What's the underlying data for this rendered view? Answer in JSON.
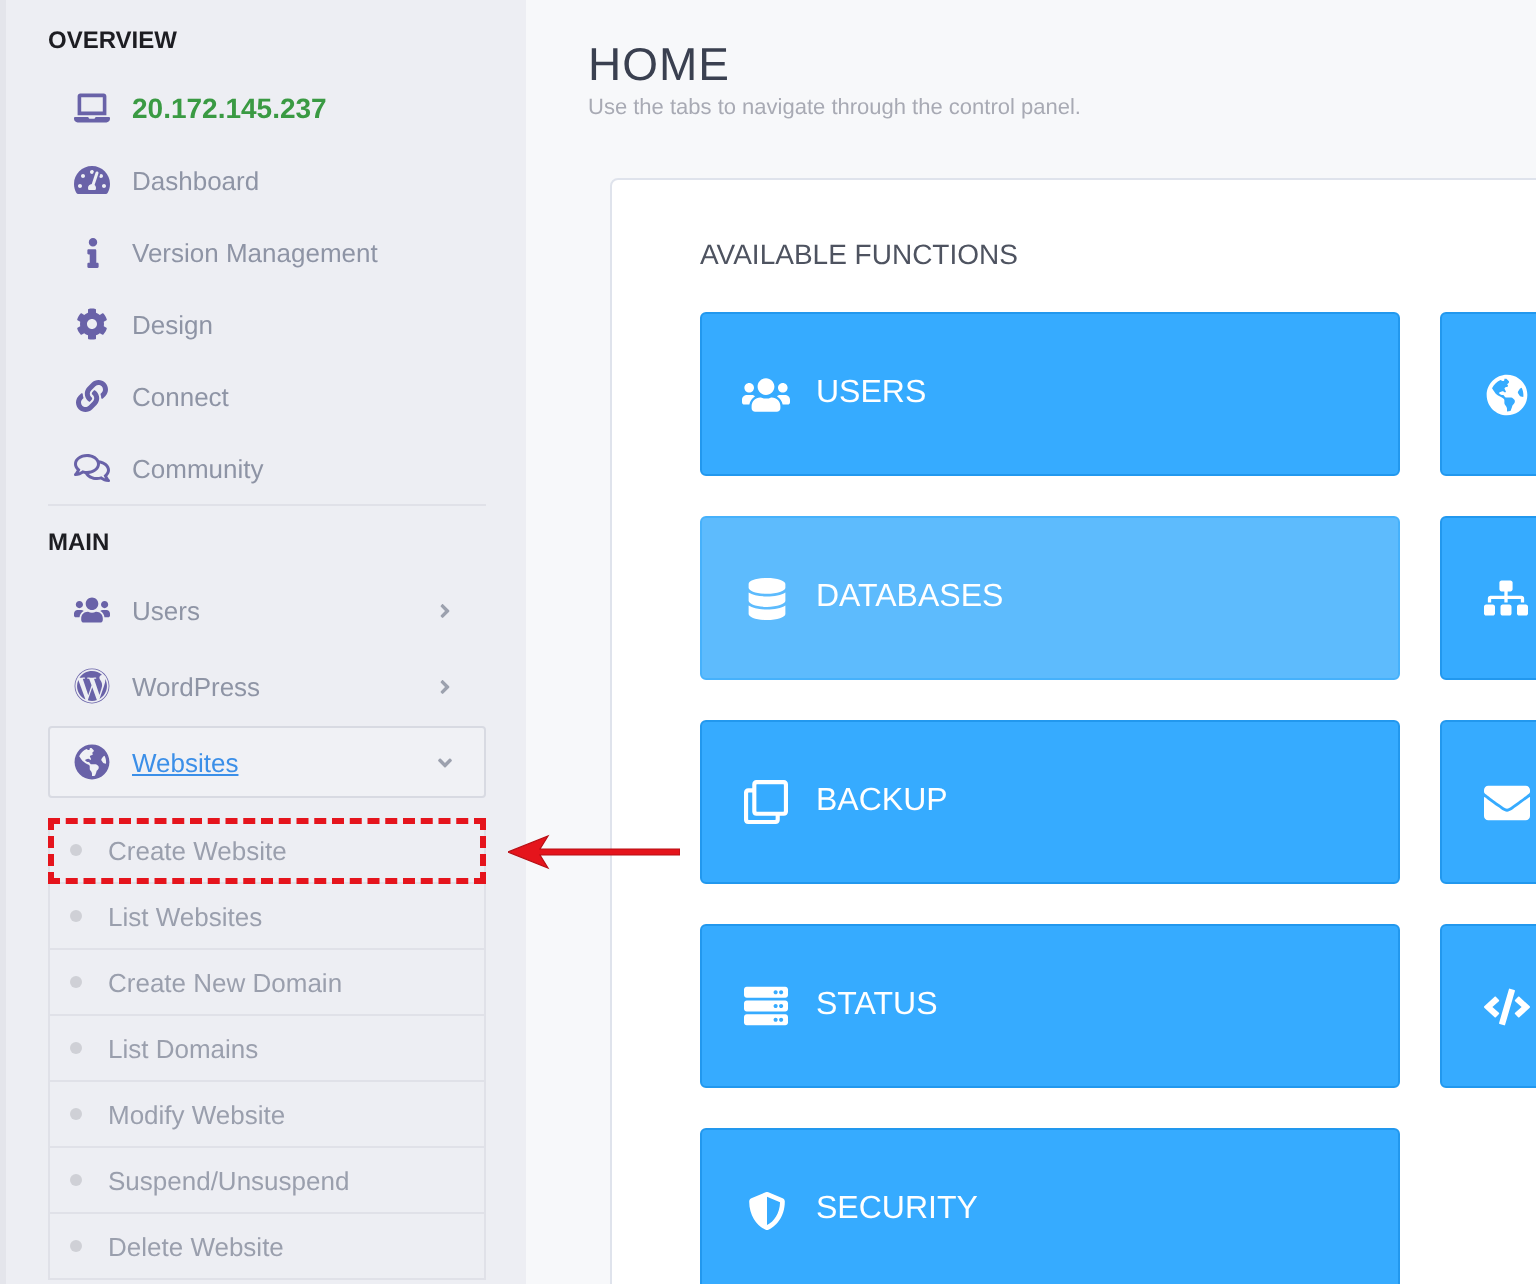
{
  "sidebar": {
    "sections": [
      {
        "title": "OVERVIEW",
        "items": [
          {
            "kind": "host",
            "label": "20.172.145.237"
          },
          {
            "kind": "link",
            "label": "Dashboard"
          },
          {
            "kind": "link",
            "label": "Version Management"
          },
          {
            "kind": "link",
            "label": "Design"
          },
          {
            "kind": "link",
            "label": "Connect"
          },
          {
            "kind": "link",
            "label": "Community"
          }
        ]
      },
      {
        "title": "MAIN",
        "items": [
          {
            "kind": "menu",
            "label": "Users",
            "expanded": false
          },
          {
            "kind": "menu",
            "label": "WordPress",
            "expanded": false
          },
          {
            "kind": "menu",
            "label": "Websites",
            "expanded": true,
            "children": [
              {
                "label": "Create Website",
                "annotated": true
              },
              {
                "label": "List Websites",
                "annotated": false
              },
              {
                "label": "Create New Domain",
                "annotated": false
              },
              {
                "label": "List Domains",
                "annotated": false
              },
              {
                "label": "Modify Website",
                "annotated": false
              },
              {
                "label": "Suspend/Unsuspend",
                "annotated": false
              },
              {
                "label": "Delete Website",
                "annotated": false
              }
            ]
          }
        ]
      }
    ]
  },
  "page": {
    "title": "HOME",
    "subtitle": "Use the tabs to navigate through the control panel."
  },
  "functions": {
    "heading": "AVAILABLE FUNCTIONS",
    "tiles": [
      {
        "label": "USERS",
        "highlighted": false
      },
      {
        "highlighted": false
      },
      {
        "label": "DATABASES",
        "highlighted": true
      },
      {
        "highlighted": false
      },
      {
        "label": "BACKUP",
        "highlighted": false
      },
      {
        "highlighted": false
      },
      {
        "label": "STATUS",
        "highlighted": false
      },
      {
        "highlighted": false
      },
      {
        "label": "SECURITY",
        "highlighted": false
      }
    ]
  }
}
